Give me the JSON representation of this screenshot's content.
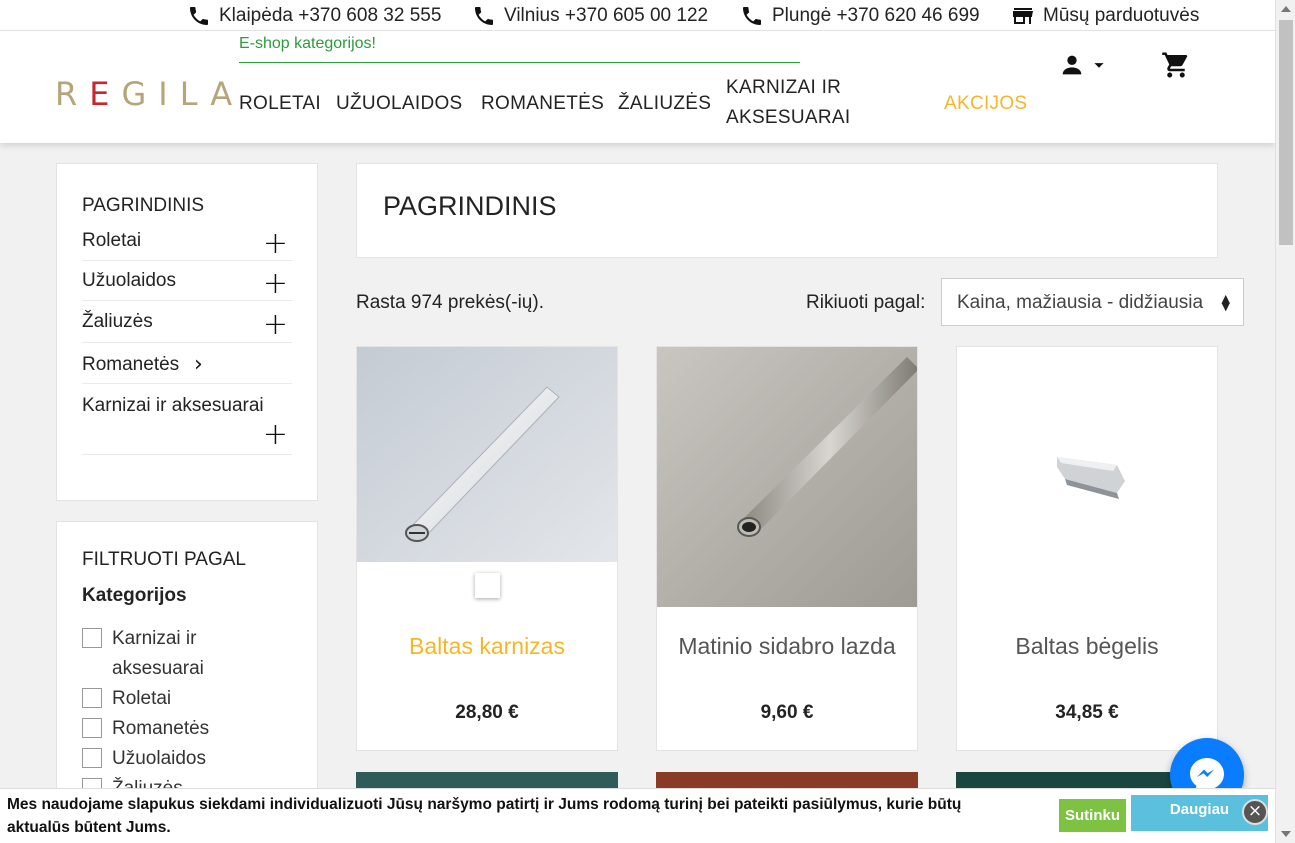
{
  "contacts": [
    {
      "icon": "phone-icon",
      "text": "Klaipėda +370 608 32 555"
    },
    {
      "icon": "phone-icon",
      "text": "Vilnius +370 605 00 122"
    },
    {
      "icon": "phone-icon",
      "text": "Plungė +370 620 46 699"
    },
    {
      "icon": "store-icon",
      "text": "Mūsų parduotuvės"
    }
  ],
  "header": {
    "logo": "REGILA",
    "eshop_link": "E-shop kategorijos!",
    "nav": [
      "ROLETAI",
      "UŽUOLAIDOS",
      "ROMANETĖS",
      "ŽALIUZĖS",
      "KARNIZAI IR AKSESUARAI",
      "AKCIJOS"
    ]
  },
  "sidebar": {
    "title": "PAGRINDINIS",
    "categories": [
      {
        "label": "Roletai",
        "toggle": "+"
      },
      {
        "label": "Užuolaidos",
        "toggle": "+"
      },
      {
        "label": "Žaliuzės",
        "toggle": "+"
      },
      {
        "label": "Romanetės",
        "toggle": "›"
      },
      {
        "label": "Karnizai ir aksesuarai",
        "toggle": "+"
      }
    ],
    "filter_title": "FILTRUOTI PAGAL",
    "filter_sub": "Kategorijos",
    "filter_options": [
      "Karnizai ir aksesuarai",
      "Roletai",
      "Romanetės",
      "Užuolaidos",
      "Žaliuzės"
    ]
  },
  "main": {
    "title": "PAGRINDINIS",
    "count": "Rasta 974 prekės(-ių).",
    "sort_label": "Rikiuoti pagal:",
    "sort_value": "Kaina, mažiausia - didžiausia"
  },
  "products": [
    {
      "name": "Baltas karnizas",
      "price": "28,80 €"
    },
    {
      "name": "Matinio sidabro lazda",
      "price": "9,60 €"
    },
    {
      "name": "Baltas bėgelis",
      "price": "34,85 €"
    }
  ],
  "cookie": {
    "text": "Mes naudojame slapukus siekdami individualizuoti Jūsų naršymo patirtį ir Jums rodomą turinį bei pateikti pasiūlymus, kurie būtų aktualūs būtent Jums.",
    "accept": "Sutinku",
    "more": "Daugiau",
    "close": "×"
  },
  "colors": {
    "accent": "#f5b728",
    "green": "#2e9a3f",
    "brand_gold": "#b6a57a",
    "brand_red": "#c8262e"
  }
}
